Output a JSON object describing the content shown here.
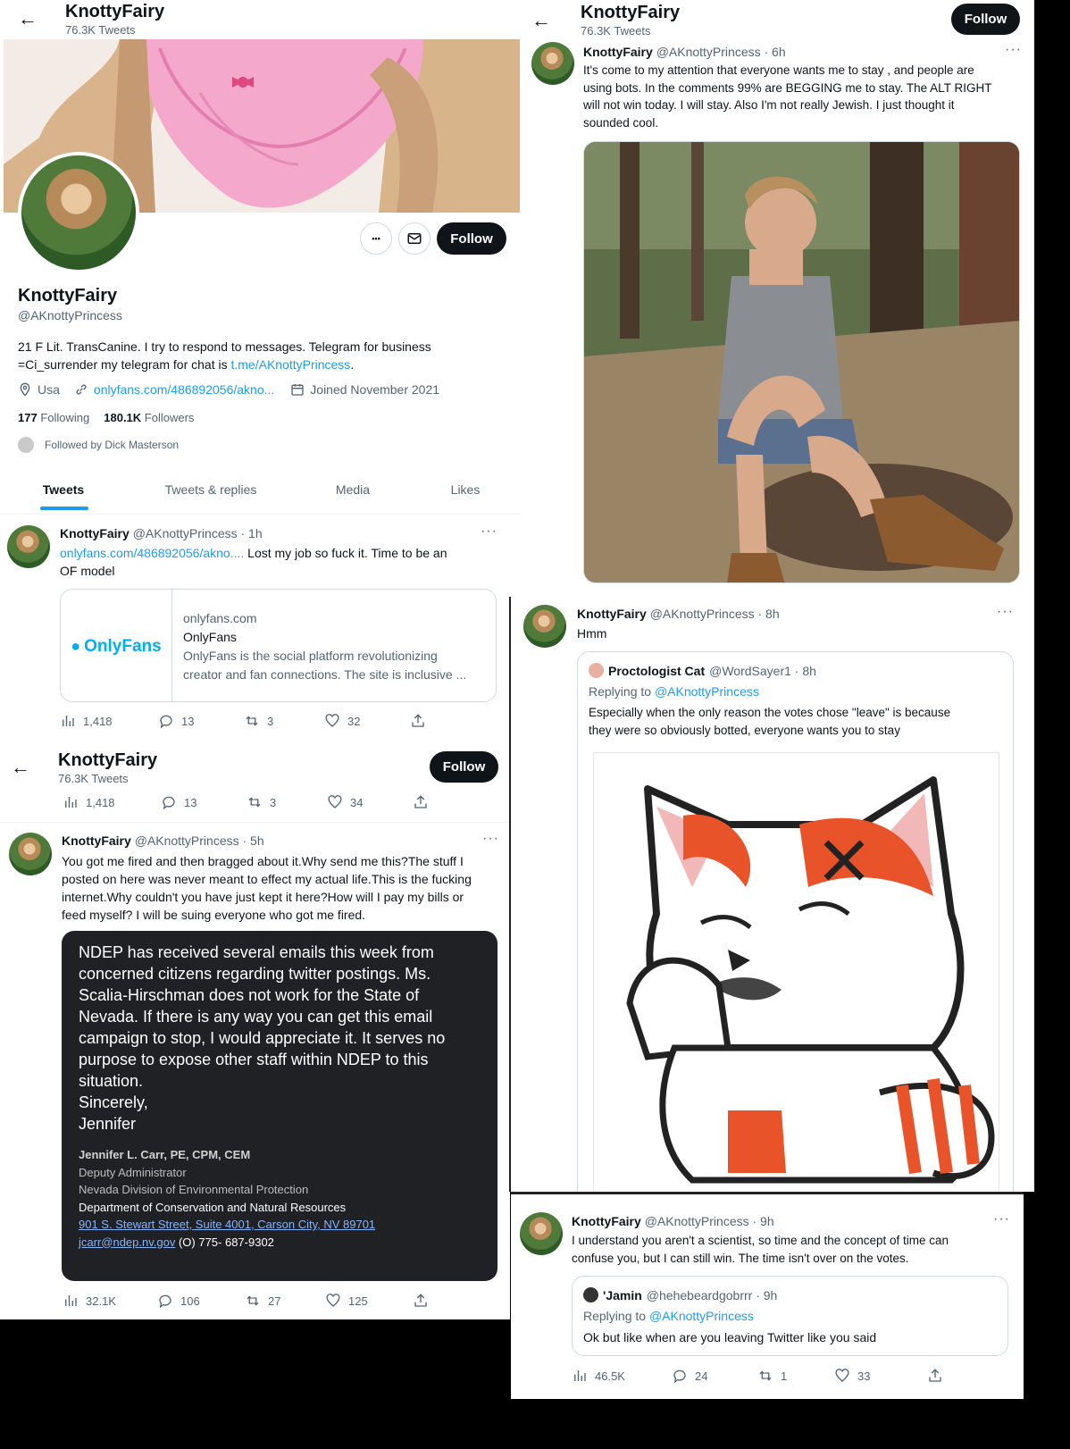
{
  "profile": {
    "header_name": "KnottyFairy",
    "header_tweets": "76.3K Tweets",
    "name": "KnottyFairy",
    "handle": "@AKnottyPrincess",
    "bio_line1": "21 F Lit. TransCanine. I try to respond to messages. Telegram for business",
    "bio_line2_prefix": "=Ci_surrender my telegram for chat is ",
    "bio_link": "t.me/AKnottyPrincess",
    "bio_suffix": ".",
    "location": "Usa",
    "website": "onlyfans.com/486892056/akno...",
    "joined": "Joined November 2021",
    "following_count": "177",
    "following_label": "Following",
    "followers_count": "180.1K",
    "followers_label": "Followers",
    "followed_by": "Followed by Dick Masterson",
    "follow_label": "Follow",
    "more_label": "•••",
    "tabs": [
      "Tweets",
      "Tweets & replies",
      "Media",
      "Likes"
    ],
    "active_tab_color": "#1d9bf0"
  },
  "tweet1": {
    "name": "KnottyFairy",
    "meta": "@AKnottyPrincess · 1h",
    "link": "onlyfans.com/486892056/akno....",
    "text_after_link": "  Lost my job so fuck it. Time to be an",
    "text_line2": "OF model",
    "card_domain": "onlyfans.com",
    "card_title": "OnlyFans",
    "card_desc1": "OnlyFans is the social platform revolutionizing",
    "card_desc2": "creator and fan connections. The site is inclusive ...",
    "card_logo": "OnlyFans",
    "brand_color": "#00aff0",
    "views": "1,418",
    "replies": "13",
    "retweets": "3",
    "likes": "32"
  },
  "panel3": {
    "header_name": "KnottyFairy",
    "header_tweets": "76.3K Tweets",
    "follow_label": "Follow",
    "views": "1,418",
    "replies": "13",
    "retweets": "3",
    "likes": "34"
  },
  "tweet2": {
    "name": "KnottyFairy",
    "meta": "@AKnottyPrincess · 5h",
    "lines": [
      "You got me fired and then bragged about it.Why send me this?The stuff I",
      "posted on here was never meant to effect my actual life.This is the fucking",
      "internet.Why couldn't you have just kept it here?How will I pay my bills or",
      "feed myself? I will be suing everyone who got me fired."
    ],
    "email_lines": [
      "NDEP has received several emails this week from",
      "concerned citizens regarding twitter postings.  Ms.",
      "Scalia-Hirschman does not work for the State of",
      "Nevada.  If there is any way you can get this email",
      "campaign to stop, I would appreciate it.  It serves no",
      "purpose to expose other staff within NDEP to this",
      "situation.",
      "Sincerely,",
      "Jennifer"
    ],
    "sig_name": "Jennifer L. Carr, PE, CPM, CEM",
    "sig_lines": [
      "Deputy Administrator",
      "Nevada Division of Environmental Protection",
      "Department of Conservation and Natural Resources"
    ],
    "sig_address": "901 S. Stewart Street, Suite 4001, Carson City, NV 89701",
    "sig_email": "jcarr@ndep.nv.gov",
    "sig_phone": " (O) 775- 687-9302",
    "views": "32.1K",
    "replies": "106",
    "retweets": "27",
    "likes": "125"
  },
  "panel2": {
    "header_name": "KnottyFairy",
    "header_tweets": "76.3K Tweets",
    "follow_label": "Follow",
    "name": "KnottyFairy",
    "meta": "@AKnottyPrincess · 6h",
    "lines": [
      "It's come to my attention that everyone wants me to stay , and people are",
      "using bots. In the comments 99% are BEGGING me to stay. The ALT RIGHT",
      "will not win today. I will stay. Also I'm not really Jewish. I just thought it",
      "sounded cool."
    ]
  },
  "panel4": {
    "name": "KnottyFairy",
    "meta": "@AKnottyPrincess · 8h",
    "text": "Hmm",
    "quote_name": "Proctologist Cat",
    "quote_meta": "@WordSayer1 · 8h",
    "quote_reply_prefix": "Replying to ",
    "quote_reply_handle": "@AKnottyPrincess",
    "quote_line1": "Especially when the only reason the votes chose \"leave\" is because",
    "quote_line2": "they were so obviously botted, everyone wants you to stay",
    "sticker_color": "#e8532a"
  },
  "panel5": {
    "name": "KnottyFairy",
    "meta": "@AKnottyPrincess · 9h",
    "line1": "I understand you aren't a scientist, so time and the concept of time can",
    "line2": "confuse you, but I can still win. The time isn't over on the votes.",
    "quote_name": "'Jamin",
    "quote_meta": "@hehebeardgobrrr · 9h",
    "quote_reply_prefix": "Replying to ",
    "quote_reply_handle": "@AKnottyPrincess",
    "quote_text": "Ok but like when are you leaving Twitter like you said",
    "views": "46.5K",
    "replies": "24",
    "retweets": "1",
    "likes": "33"
  }
}
